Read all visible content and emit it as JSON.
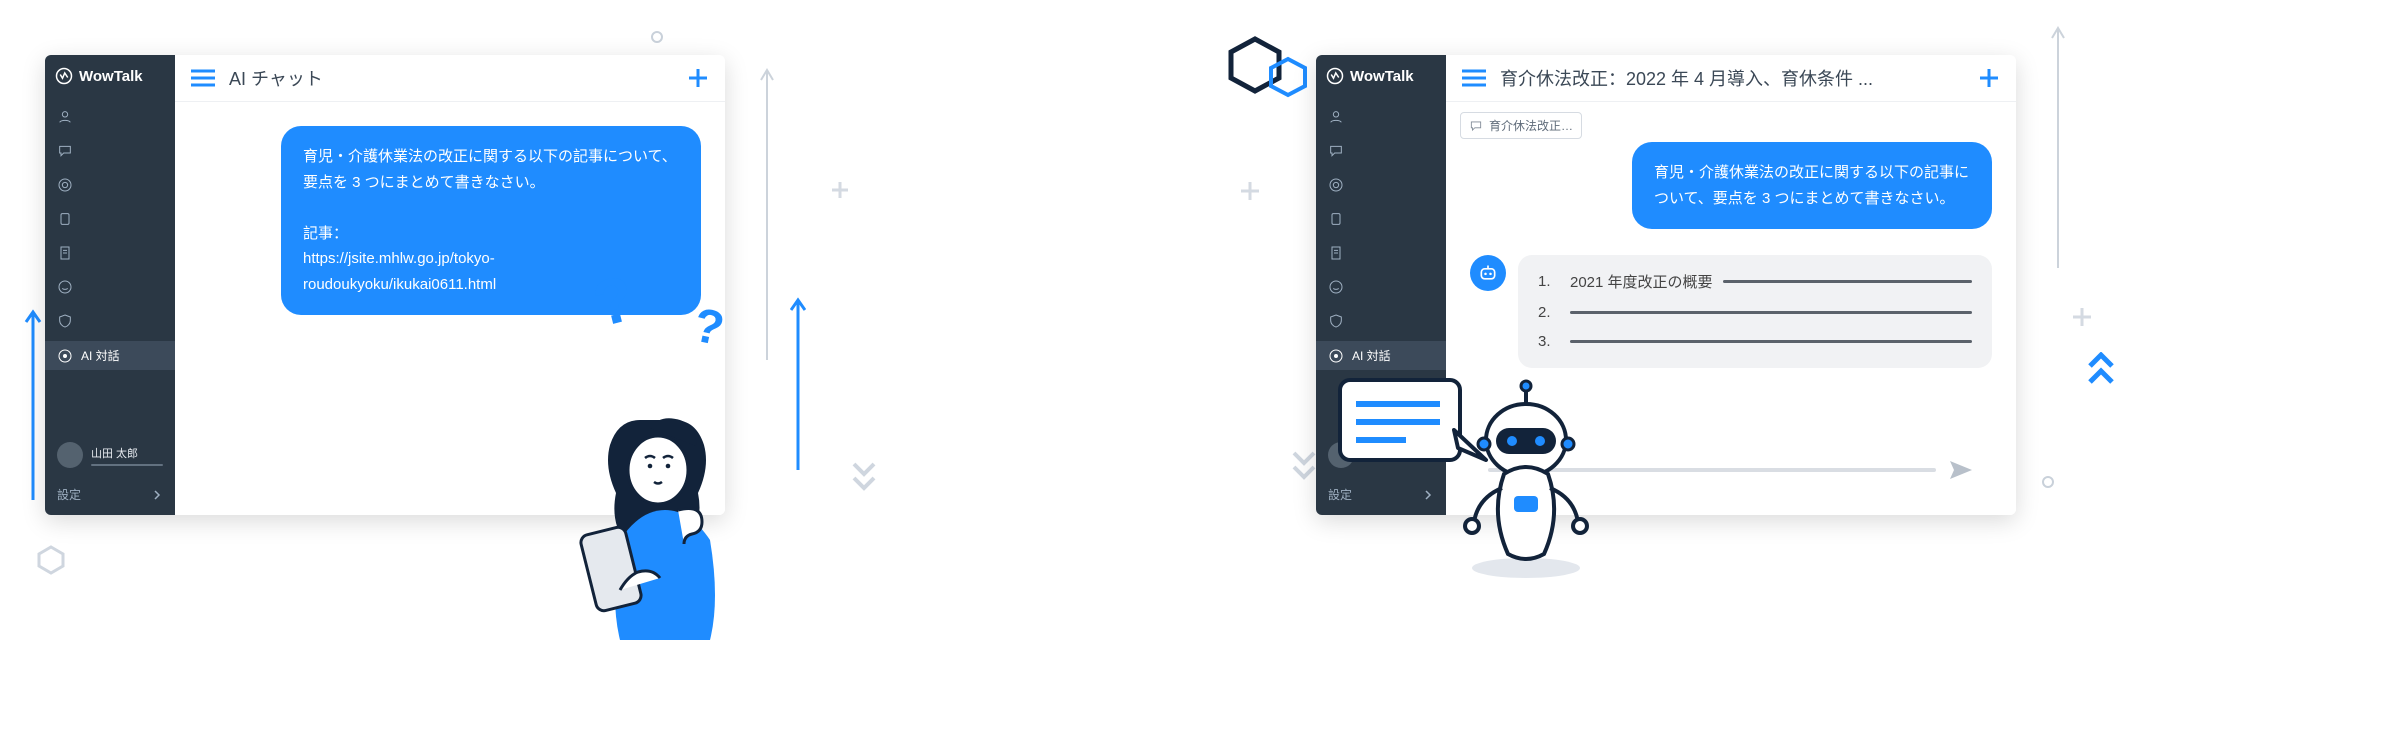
{
  "brand": "WowTalk",
  "sidebar": {
    "ai_label": "AI 対話",
    "user_name": "山田 太郎",
    "settings": "設定"
  },
  "left": {
    "title": "AI チャット",
    "user_message": "育児・介護休業法の改正に関する以下の記事について、要点を 3 つにまとめて書きなさい。\n\n記事：\nhttps://jsite.mhlw.go.jp/tokyo-roudoukyoku/ikukai0611.html"
  },
  "right": {
    "title": "育介休法改正：2022 年 4 月導入、育休条件 ...",
    "tab_label": "育介休法改正…",
    "user_message": "育児・介護休業法の改正に関する以下の記事について、要点を 3 つにまとめて書きなさい。",
    "bot": {
      "item1_num": "1.",
      "item1_text": "2021 年度改正の概要",
      "item2_num": "2.",
      "item3_num": "3."
    }
  }
}
